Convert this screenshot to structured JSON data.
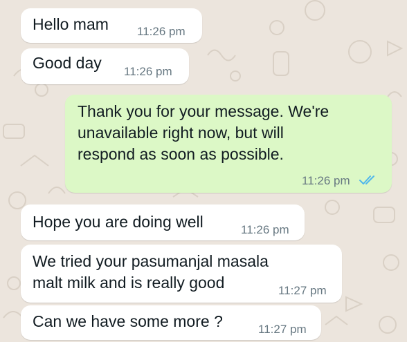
{
  "theme": {
    "wallpaper_color": "#ece5dd",
    "incoming_bubble_color": "#ffffff",
    "outgoing_bubble_color": "#dcf8c6",
    "read_tick_color": "#4fb6ec"
  },
  "messages": [
    {
      "direction": "incoming",
      "lines": [
        "Hello mam"
      ],
      "time": "11:26 pm"
    },
    {
      "direction": "incoming",
      "lines": [
        "Good day"
      ],
      "time": "11:26 pm"
    },
    {
      "direction": "outgoing",
      "lines": [
        "Thank you for your message. We're",
        "unavailable right now, but will",
        "respond as soon as possible."
      ],
      "time": "11:26 pm",
      "status_icon": "double-check-read-icon"
    },
    {
      "direction": "incoming",
      "lines": [
        "Hope you are doing well"
      ],
      "time": "11:26 pm"
    },
    {
      "direction": "incoming",
      "lines": [
        "We tried your pasumanjal masala",
        "malt milk and is really good"
      ],
      "time": "11:27 pm"
    },
    {
      "direction": "incoming",
      "lines": [
        "Can we have some more ?"
      ],
      "time": "11:27 pm"
    }
  ]
}
